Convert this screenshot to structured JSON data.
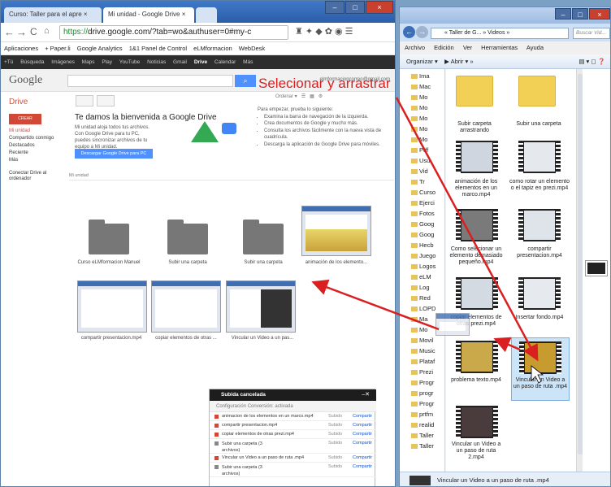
{
  "chrome": {
    "tabs": [
      "Curso: Taller para el apre",
      "Mi unidad - Google Drive"
    ],
    "url_secure": "https://",
    "url_rest": "drive.google.com/?tab=wo&authuser=0#my-c",
    "bookmarks": [
      "Aplicaciones",
      "+ Paper.li",
      "Google Analytics",
      "1&1 Panel de Control",
      "eLMformacion",
      "WebDesk"
    ],
    "google_bar": [
      "+Tú",
      "Búsqueda",
      "Imágenes",
      "Maps",
      "Play",
      "YouTube",
      "Noticias",
      "Gmail",
      "Drive",
      "Calendar",
      "Más"
    ],
    "logo": "Google",
    "email": "elmformacioncorreo@gmail.com"
  },
  "drive": {
    "section_title": "Drive",
    "create_label": "CREAR",
    "nav": [
      "Mi unidad",
      "Compartido conmigo",
      "Destacados",
      "Reciente",
      "Más"
    ],
    "connect": "Conectar Drive al ordenador",
    "breadcrumb": "Mi unidad",
    "welcome_title": "Te damos la bienvenida a Google Drive",
    "welcome_text": "Mi unidad aloja todos tus archivos. Con Google Drive para tu PC, puedes sincronizar archivos de tu equipo a Mi unidad.",
    "download_label": "Descargar Google Drive para PC",
    "tips_intro": "Para empezar, prueba lo siguiente:",
    "tips": [
      "Examina la barra de navegación de la izquierda.",
      "Crea documentos de Google y mucho más.",
      "Consulta los archivos fácilmente con la nueva vista de cuadrícula.",
      "Descarga la aplicación de Google Drive para móviles."
    ],
    "sort_label": "Ordenar",
    "items_row1": [
      "Curso eLMformacion Manuel",
      "Subir una carpeta",
      "Subir una carpeta",
      "animación de los elemento..."
    ],
    "items_row2": [
      "compartir presentacion.mp4",
      "copiar elementos de otras ...",
      "Vincular un Video a un pas..."
    ]
  },
  "upload_panel": {
    "title": "Subida cancelada",
    "subtitle": "Configuración  Conversión: activada",
    "rows": [
      {
        "name": "animacion de los elementos en un marco.mp4",
        "status": "Subido",
        "action": "Compartir"
      },
      {
        "name": "compartir presentacion.mp4",
        "status": "Subido",
        "action": "Compartir"
      },
      {
        "name": "copiar elementos de otras prezi.mp4",
        "status": "Subido",
        "action": "Compartir"
      },
      {
        "name": "Subir una carpeta (3 archivos)",
        "status": "Subido",
        "action": "Compartir"
      },
      {
        "name": "Vincular un Video a un paso de ruta .mp4",
        "status": "Subido",
        "action": "Compartir"
      },
      {
        "name": "Subir una carpeta (3 archivos)",
        "status": "Subido",
        "action": "Compartir"
      }
    ]
  },
  "overlay_text": "Selecionar y arrastrar",
  "explorer": {
    "crumb": "« Taller de G... » Videos »",
    "search_placeholder": "Buscar Vid...",
    "menu": [
      "Archivo",
      "Edición",
      "Ver",
      "Herramientas",
      "Ayuda"
    ],
    "organize": "Organizar ▾",
    "open": "Abrir ▾",
    "tree": [
      "Ima",
      "Mac",
      "Mo",
      "Mo",
      "Mo",
      "Mo",
      "Mo",
      "Pdf",
      "Usu",
      "Vid",
      "Tr",
      "Curso",
      "Ejerci",
      "Fotos",
      "Goog",
      "Goog",
      "Hecb",
      "Juego",
      "Logos",
      "eLM",
      "Log",
      "Red",
      "LOPD",
      "Ma",
      "Mo",
      "Movil",
      "Music",
      "Plataf",
      "Prezi",
      "Progr",
      "progr",
      "Progr",
      "prtfm",
      "realid",
      "Taller",
      "Taller"
    ],
    "files": [
      "Subir carpeta arrastrando",
      "Subir una carpeta",
      "animación de los elementos en un marco.mp4",
      "como rotar un elemento o el tapiz en prezi.mp4",
      "Como selecionar un elemento demasiado pequeño.mp4",
      "compartir presentacion.mp4",
      "copiar elementos de otras prezi.mp4",
      "Insertar fondo.mp4",
      "problema texto.mp4",
      "Vincular un Video a un paso de ruta .mp4",
      "Vincular un Video a un paso de ruta 2.mp4"
    ],
    "status": "Vincular un Video a un paso de ruta .mp4"
  }
}
